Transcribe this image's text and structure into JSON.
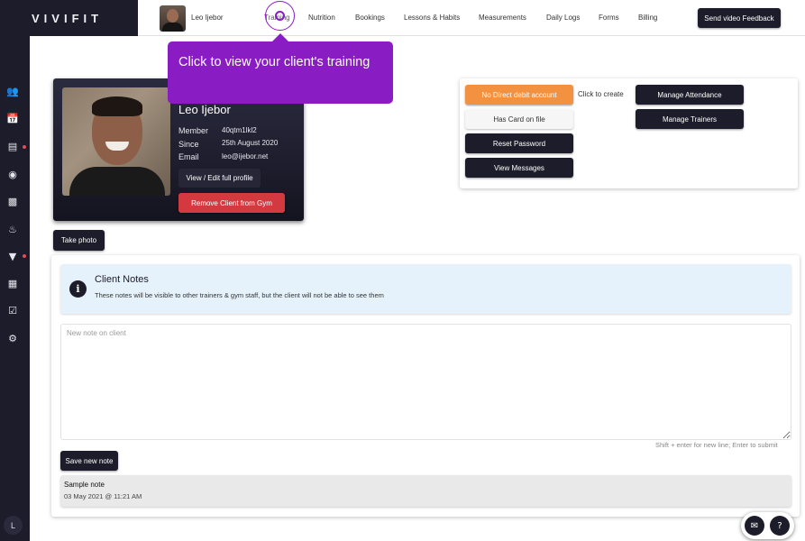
{
  "brand": {
    "name": "VIVIFIT"
  },
  "header": {
    "client_name": "Leo Ijebor",
    "nav": [
      "Training",
      "Nutrition",
      "Bookings",
      "Lessons & Habits",
      "Measurements",
      "Daily Logs",
      "Forms",
      "Billing"
    ],
    "feedback_label": "Send video Feedback"
  },
  "sidebar": {
    "icons": [
      "clients-icon",
      "calendar-icon",
      "programs-icon",
      "target-icon",
      "chart-icon",
      "nutrition-icon",
      "filter-icon",
      "book-icon",
      "checklist-icon",
      "settings-icon"
    ],
    "avatar_initial": "L"
  },
  "tooltip": {
    "text": "Click to view your client's training"
  },
  "profile": {
    "name": "Leo Ijebor",
    "member_label": "Member",
    "member_value": "40qtm1lkl2",
    "since_label": "Since",
    "since_value": "25th August 2020",
    "email_label": "Email",
    "email_value": "leo@ijebor.net",
    "edit_label": "View / Edit full profile",
    "remove_label": "Remove Client from Gym"
  },
  "take_photo_label": "Take photo",
  "actions": {
    "direct_debit": "No Direct debit account",
    "click_to_create": "Click to create",
    "has_card": "Has Card on file",
    "reset_password": "Reset Password",
    "view_messages": "View Messages",
    "manage_attendance": "Manage Attendance",
    "manage_trainers": "Manage Trainers"
  },
  "notes": {
    "title": "Client Notes",
    "description": "These notes will be visible to other trainers & gym staff, but the client will not be able to see them",
    "placeholder": "New note on client",
    "hint": "Shift + enter for new line; Enter to submit",
    "save_label": "Save new note",
    "items": [
      {
        "title": "Sample note",
        "date": "03 May 2021 @ 11:21 AM"
      }
    ]
  },
  "colors": {
    "dark": "#1c1c2a",
    "accent": "#8a1cc4",
    "orange": "#f2913f",
    "danger": "#d23a3f"
  }
}
